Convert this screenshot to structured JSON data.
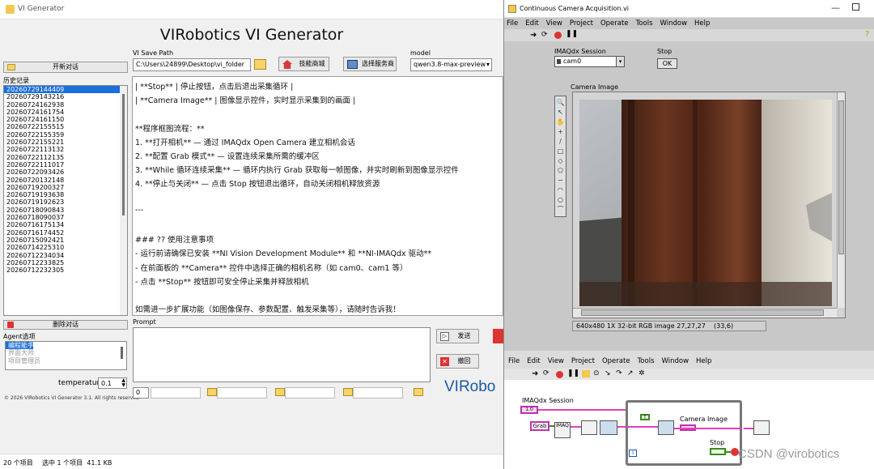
{
  "vi_generator": {
    "window_title": "VI Generator",
    "app_title": "VIRobotics VI Generator",
    "new_chat_label": "开新对话",
    "history_label": "历史记录",
    "history_items": [
      "20260729144409",
      "20260729143216",
      "20260724162938",
      "20260724161754",
      "20260724161150",
      "20260722155515",
      "20260722155359",
      "20260722155221",
      "20260722113132",
      "20260722112135",
      "20260722111017",
      "20260722093426",
      "20260720132148",
      "20260719200327",
      "20260719193638",
      "20260719192623",
      "20260718090843",
      "20260718090037",
      "20260716175134",
      "20260716174452",
      "20260715092421",
      "20260714225310",
      "20260712234034",
      "20260712233825",
      "20260712232305"
    ],
    "delete_chat_label": "删除对话",
    "agent_label": "Agent选项",
    "agent_options": [
      "编程能手",
      "界面大师",
      "项目管理员"
    ],
    "temperature_label": "temperature",
    "temperature_value": "0.1",
    "copyright": "© 2026 VIRobotics VI Generator 3.1. All rights reserved",
    "save_path_label": "VI Save Path",
    "save_path_value": "C:\\Users\\24899\\Desktop\\vi_folder",
    "skill_store_label": "技能商城",
    "service_store_label": "选择服务商",
    "model_label": "model",
    "model_value": "qwen3.8-max-preview",
    "content_lines": [
      "| **Stop** | 停止按钮，点击后退出采集循环 |",
      "| **Camera Image** | 图像显示控件，实时显示采集到的画面 |",
      "",
      "**程序框图流程：**",
      "1. **打开相机** — 通过 IMAQdx Open Camera 建立相机会话",
      "2. **配置 Grab 模式** — 设置连续采集所需的缓冲区",
      "3. **While 循环连续采集** — 循环内执行 Grab 获取每一帧图像，并实时刷新到图像显示控件",
      "4. **停止与关闭** — 点击 Stop 按钮退出循环，自动关闭相机释放资源",
      "",
      "---",
      "",
      "### ?? 使用注意事项",
      "- 运行前请确保已安装 **NI Vision Development Module** 和 **NI-IMAQdx 驱动**",
      "- 在前面板的 **Camera** 控件中选择正确的相机名称（如 cam0、cam1 等）",
      "- 点击 **Stop** 按钮即可安全停止采集并释放相机",
      "",
      "如需进一步扩展功能（如图像保存、参数配置、触发采集等），请随时告诉我！"
    ],
    "prompt_label": "Prompt",
    "send_label": "发送",
    "cancel_label": "撤回",
    "bottom_field_value": "0",
    "logo_text": "VIRobo"
  },
  "status_bar": {
    "items_count": "20 个项目",
    "selected": "选中 1 个项目  41.1 KB"
  },
  "front_panel": {
    "title": "Continuous Camera Acquisition.vi",
    "menu": [
      "File",
      "Edit",
      "View",
      "Project",
      "Operate",
      "Tools",
      "Window",
      "Help"
    ],
    "session_label": "IMAQdx Session",
    "session_value": "cam0",
    "stop_label": "Stop",
    "ok_label": "OK",
    "camera_label": "Camera Image",
    "image_info": "640x480 1X 32-bit RGB image 27,27,27    (33,6)"
  },
  "block_diagram": {
    "menu": [
      "File",
      "Edit",
      "View",
      "Project",
      "Operate",
      "Tools",
      "Window",
      "Help"
    ],
    "session_label": "IMAQdx Session",
    "grab_label": "Grab",
    "camera_image_label": "Camera Image",
    "stop_label": "Stop",
    "const_label": "1.0",
    "iter_label": "i",
    "true_label": "T",
    "imaq_label": "IMAQ"
  },
  "watermark": "CSDN @virobotics",
  "colors": {
    "selection": "#1a6fd8",
    "lv_grey": "#c8c8c8",
    "wire_pink": "#e040c0",
    "wire_green": "#3b8a1e"
  }
}
